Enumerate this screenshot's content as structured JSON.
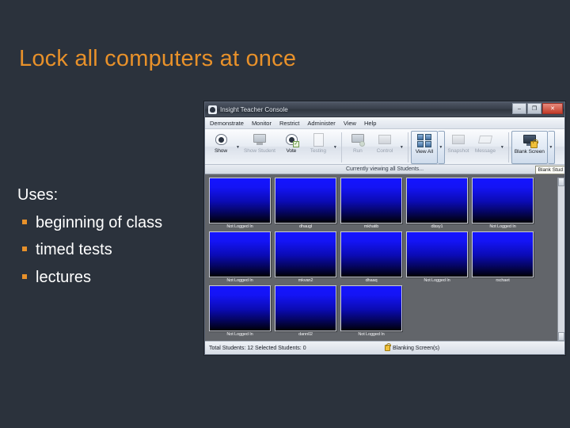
{
  "slide": {
    "title": "Lock all computers at once",
    "uses_heading": "Uses:",
    "bullets": [
      "beginning of class",
      "timed tests",
      "lectures"
    ],
    "colors": {
      "background": "#2b323c",
      "title": "#e8912a",
      "bullet_marker": "#e8912a",
      "body_text": "#ffffff"
    }
  },
  "app": {
    "window_title": "Insight Teacher Console",
    "window_controls": {
      "minimize": "–",
      "maximize": "❐",
      "close": "✕"
    },
    "menu": [
      {
        "label": "Demonstrate"
      },
      {
        "label": "Monitor"
      },
      {
        "label": "Restrict"
      },
      {
        "label": "Administer"
      },
      {
        "label": "View"
      },
      {
        "label": "Help"
      }
    ],
    "toolbar": [
      {
        "label": "Show",
        "icon": "show-icon",
        "enabled": true,
        "caret": true,
        "active": false
      },
      {
        "label": "Show Student",
        "icon": "show-student-icon",
        "enabled": false,
        "caret": false,
        "active": false
      },
      {
        "label": "Vote",
        "icon": "vote-icon",
        "enabled": true,
        "caret": false,
        "active": false
      },
      {
        "label": "Testing",
        "icon": "testing-icon",
        "enabled": false,
        "caret": true,
        "active": false
      },
      {
        "label": "Run",
        "icon": "run-icon",
        "enabled": false,
        "caret": false,
        "active": false
      },
      {
        "label": "Control",
        "icon": "control-icon",
        "enabled": false,
        "caret": true,
        "active": false
      },
      {
        "label": "View All",
        "icon": "view-all-grid-icon",
        "enabled": true,
        "caret": true,
        "active": true
      },
      {
        "label": "Snapshot",
        "icon": "snapshot-icon",
        "enabled": false,
        "caret": false,
        "active": false
      },
      {
        "label": "Message",
        "icon": "message-icon",
        "enabled": false,
        "caret": true,
        "active": false
      },
      {
        "label": "Blank Screen",
        "icon": "blank-screen-icon",
        "enabled": true,
        "caret": true,
        "active": true
      }
    ],
    "viewing_status": "Currently viewing all Students...",
    "tooltip": "Blank Stud",
    "thumbnails": [
      {
        "label": "Not Logged In"
      },
      {
        "label": "dhaugl"
      },
      {
        "label": "mkhatib"
      },
      {
        "label": "dlssy1"
      },
      {
        "label": "Not Logged In"
      },
      {
        "label": "Not Logged In"
      },
      {
        "label": "mkvan2"
      },
      {
        "label": "dhaaq"
      },
      {
        "label": "Not Logged In"
      },
      {
        "label": "rschaet"
      },
      {
        "label": "Not Logged In"
      },
      {
        "label": "dann02"
      },
      {
        "label": "Not Logged In"
      }
    ],
    "statusbar": {
      "totals": "Total Students: 12  Selected Students: 0",
      "activity": "Blanking Screen(s)"
    }
  }
}
